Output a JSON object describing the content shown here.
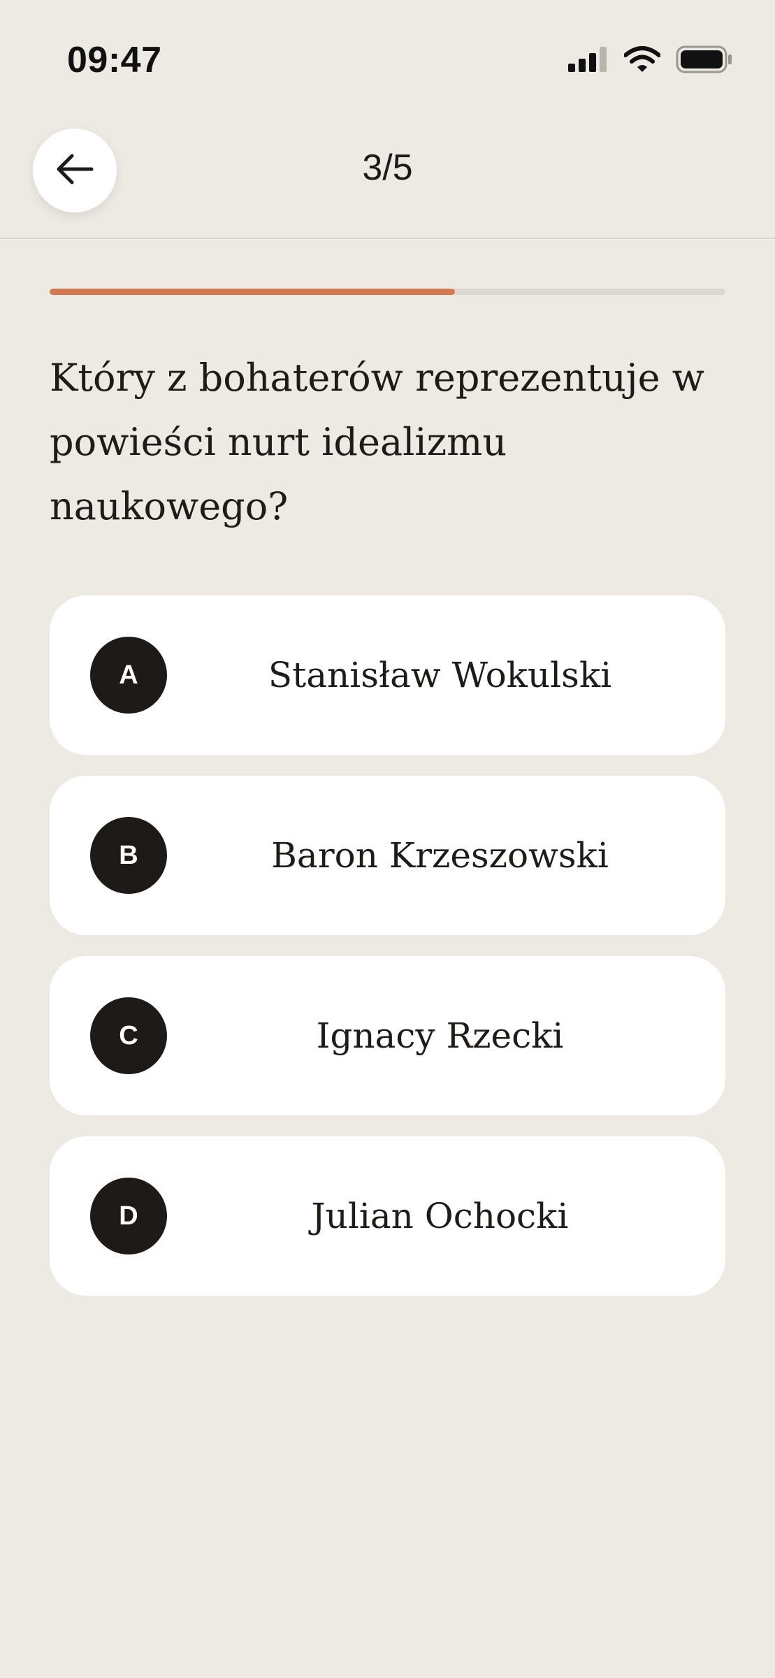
{
  "status_bar": {
    "time": "09:47",
    "icons": [
      "signal-icon",
      "wifi-icon",
      "battery-icon"
    ]
  },
  "header": {
    "back_icon": "arrow-left-icon",
    "progress_label": "3/5"
  },
  "progress": {
    "fraction": 0.6,
    "fill_color": "#D4794F",
    "track_color": "#DDD8D1"
  },
  "question": {
    "text": "Który z bohaterów reprezentuje w powieści nurt idealizmu naukowego?"
  },
  "answers": [
    {
      "letter": "A",
      "text": "Stanisław Wokulski"
    },
    {
      "letter": "B",
      "text": "Baron Krzeszowski"
    },
    {
      "letter": "C",
      "text": "Ignacy Rzecki"
    },
    {
      "letter": "D",
      "text": "Julian Ochocki"
    }
  ],
  "colors": {
    "background": "#EDE9E3",
    "card": "#FFFFFF",
    "letter_badge": "#1E1A18",
    "accent": "#D4794F"
  }
}
